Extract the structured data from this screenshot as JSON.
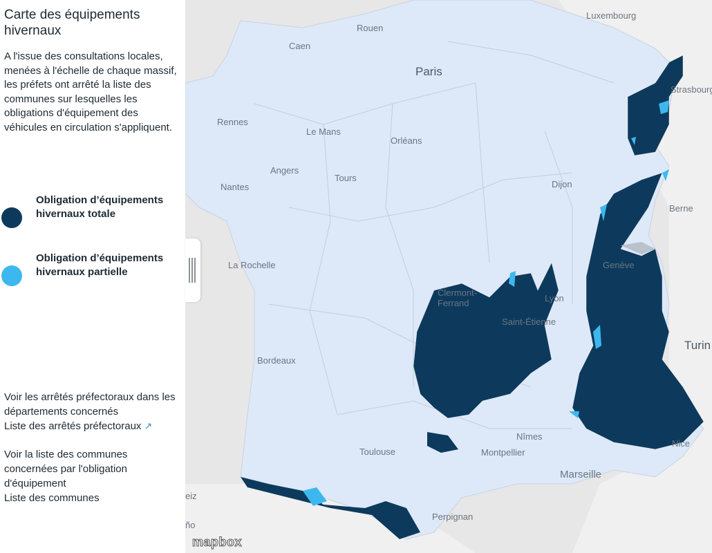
{
  "sidebar": {
    "title": "Carte des équipements hivernaux",
    "intro": "A l'issue des consultations locales, menées à l'échelle de chaque massif, les préfets ont arrêté la liste des communes sur lesquelles les obligations d'équipement des véhicules en circulation s'appliquent.",
    "legend": [
      {
        "label": "Obligation d’équipements hivernaux totale",
        "color": "#0d3a5c"
      },
      {
        "label": "Obligation d’équipements hivernaux partielle",
        "color": "#3db8ef"
      }
    ],
    "arretes_text": "Voir les arrêtés préfectoraux dans les départements concernés",
    "arretes_link": "Liste des arrêtés préfectoraux",
    "communes_text": "Voir la liste des communes concernées par l'obligation d'équipement",
    "communes_link": "Liste des communes"
  },
  "map": {
    "colors": {
      "land": "#dde8f8",
      "sea": "#e7e7e7",
      "neighbour": "#f0f0f0",
      "total": "#0d3a5c",
      "partial": "#3db8ef",
      "border": "#ffffff"
    },
    "places": [
      {
        "name": "Luxembourg",
        "id": "luxembourg"
      },
      {
        "name": "Rouen",
        "id": "rouen"
      },
      {
        "name": "Caen",
        "id": "caen"
      },
      {
        "name": "Paris",
        "id": "paris"
      },
      {
        "name": "Strasbourg",
        "id": "strasbourg"
      },
      {
        "name": "Rennes",
        "id": "rennes"
      },
      {
        "name": "Le Mans",
        "id": "le-mans"
      },
      {
        "name": "Orléans",
        "id": "orleans"
      },
      {
        "name": "Angers",
        "id": "angers"
      },
      {
        "name": "Tours",
        "id": "tours"
      },
      {
        "name": "Nantes",
        "id": "nantes"
      },
      {
        "name": "Dijon",
        "id": "dijon"
      },
      {
        "name": "Berne",
        "id": "berne"
      },
      {
        "name": "La Rochelle",
        "id": "la-rochelle"
      },
      {
        "name": "Genève",
        "id": "geneve"
      },
      {
        "name": "Clermont-Ferrand",
        "id": "clermont-ferrand"
      },
      {
        "name": "Lyon",
        "id": "lyon"
      },
      {
        "name": "Saint-Étienne",
        "id": "saint-etienne"
      },
      {
        "name": "Turin",
        "id": "turin"
      },
      {
        "name": "Bordeaux",
        "id": "bordeaux"
      },
      {
        "name": "Nîmes",
        "id": "nimes"
      },
      {
        "name": "Toulouse",
        "id": "toulouse"
      },
      {
        "name": "Montpellier",
        "id": "montpellier"
      },
      {
        "name": "Nice",
        "id": "nice"
      },
      {
        "name": "Marseille",
        "id": "marseille"
      },
      {
        "name": "Perpignan",
        "id": "perpignan"
      },
      {
        "name": "eiz",
        "id": "vitoria-partial"
      },
      {
        "name": "ño",
        "id": "logrono-partial"
      }
    ],
    "attribution": "mapbox"
  }
}
